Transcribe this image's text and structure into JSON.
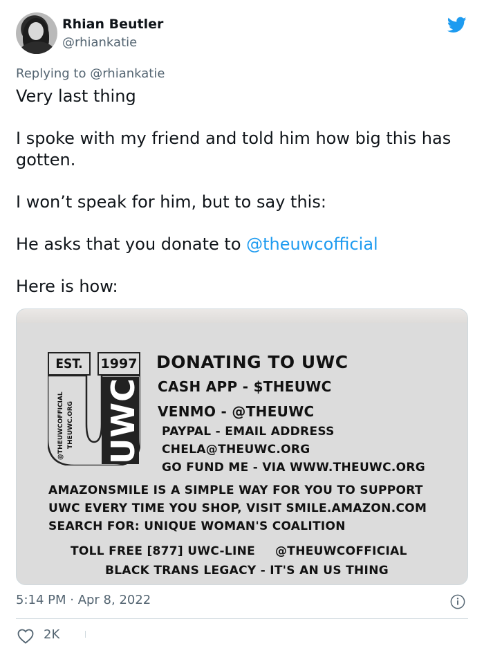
{
  "author": {
    "name": "Rhian Beutler",
    "handle": "@rhiankatie"
  },
  "reply": {
    "prefix": "Replying to",
    "mention": "@rhiankatie"
  },
  "tweet": {
    "line1": "Very last thing",
    "line2": "I spoke with my friend and told him how big this has gotten.",
    "line3": "I won’t speak for him, but to say this:",
    "line4_prefix": "He asks that you donate to ",
    "line4_mention": "@theuwcofficial",
    "line5": "Here is how:"
  },
  "image": {
    "logo": {
      "est": "EST.",
      "year": "1997",
      "brand": "UWC",
      "side1": "@THEUWCOFFICIAL",
      "side2": "THEUWC.ORG"
    },
    "title": "DONATING TO UWC",
    "cashapp": "CASH APP - $THEUWC",
    "venmo": "VENMO - @THEUWC",
    "paypal": "PAYPAL - EMAIL ADDRESS",
    "email": "CHELA@THEUWC.ORG",
    "gofundme": "GO FUND ME - VIA WWW.THEUWC.ORG",
    "amazon1": "AMAZONSMILE IS A SIMPLE WAY FOR YOU TO SUPPORT",
    "amazon2": "UWC EVERY TIME YOU SHOP, VISIT SMILE.AMAZON.COM",
    "amazon3": "SEARCH FOR: UNIQUE WOMAN'S COALITION",
    "tollfree": "TOLL FREE [877] UWC-LINE",
    "official": "@THEUWCOFFICIAL",
    "legacy": "BLACK TRANS LEGACY - IT'S AN US THING"
  },
  "meta": {
    "timestamp": "5:14 PM · Apr 8, 2022",
    "likes": "2K"
  },
  "colors": {
    "link": "#1d9bf0",
    "muted": "#536471",
    "text": "#0f1419"
  },
  "icons": [
    "twitter-bird-icon",
    "info-icon",
    "heart-icon"
  ]
}
